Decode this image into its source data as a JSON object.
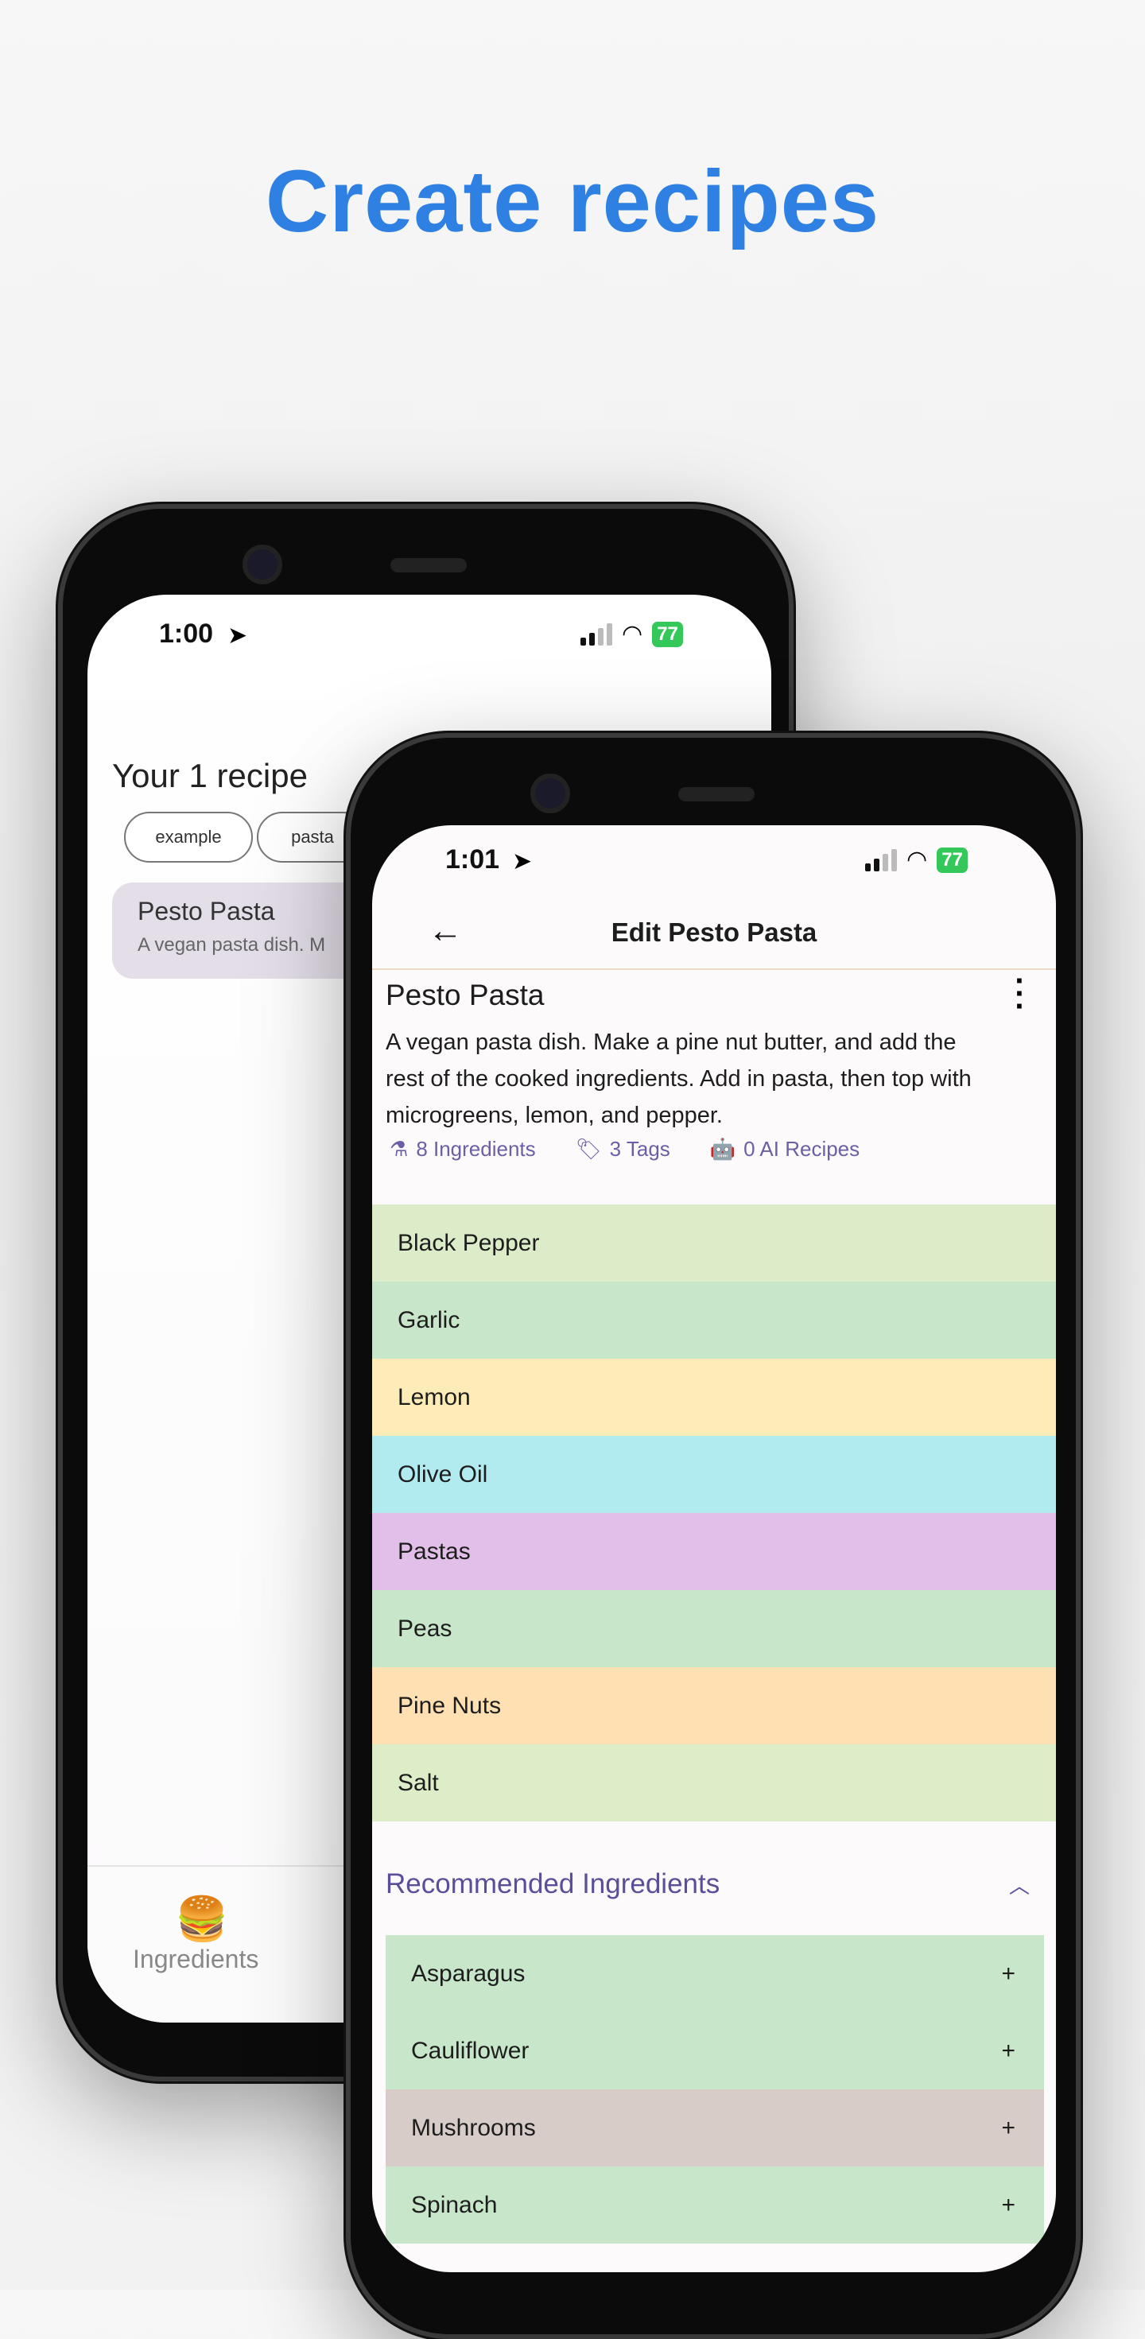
{
  "headline": "Create recipes",
  "back_phone": {
    "status": {
      "time": "1:00",
      "battery": "77"
    },
    "title": "Your 1 recipe",
    "chips": [
      "example",
      "pasta"
    ],
    "recipe_card": {
      "title": "Pesto Pasta",
      "snippet": "A vegan pasta dish. M"
    },
    "bottom_nav": {
      "ingredients_label": "Ingredients"
    }
  },
  "front_phone": {
    "status": {
      "time": "1:01",
      "battery": "77"
    },
    "nav": {
      "title": "Edit Pesto Pasta"
    },
    "recipe": {
      "title": "Pesto Pasta",
      "description": "A vegan pasta dish. Make a pine nut butter, and add the rest of the cooked ingredients. Add in pasta, then top with microgreens, lemon, and pepper."
    },
    "stats": {
      "ingredients": "8 Ingredients",
      "tags": "3 Tags",
      "ai_recipes": "0 AI Recipes"
    },
    "ingredients": [
      {
        "name": "Black Pepper",
        "color": "#dcecc9"
      },
      {
        "name": "Garlic",
        "color": "#c8e6c9"
      },
      {
        "name": "Lemon",
        "color": "#feecb8"
      },
      {
        "name": "Olive Oil",
        "color": "#b2ebef"
      },
      {
        "name": "Pastas",
        "color": "#e1bfe8"
      },
      {
        "name": "Peas",
        "color": "#c8e6c9"
      },
      {
        "name": "Pine Nuts",
        "color": "#ffe0b2"
      },
      {
        "name": "Salt",
        "color": "#dcedc8"
      }
    ],
    "recommended": {
      "title": "Recommended Ingredients",
      "items": [
        {
          "name": "Asparagus",
          "action": "+",
          "color": "#c8e6c9"
        },
        {
          "name": "Cauliflower",
          "action": "+",
          "color": "#c8e6c9"
        },
        {
          "name": "Mushrooms",
          "action": "+",
          "color": "#d7ccc8"
        },
        {
          "name": "Spinach",
          "action": "+",
          "color": "#c8e6c9"
        }
      ]
    }
  },
  "colors": {
    "headline": "#2f80e3",
    "accent": "#6b5fa5"
  }
}
